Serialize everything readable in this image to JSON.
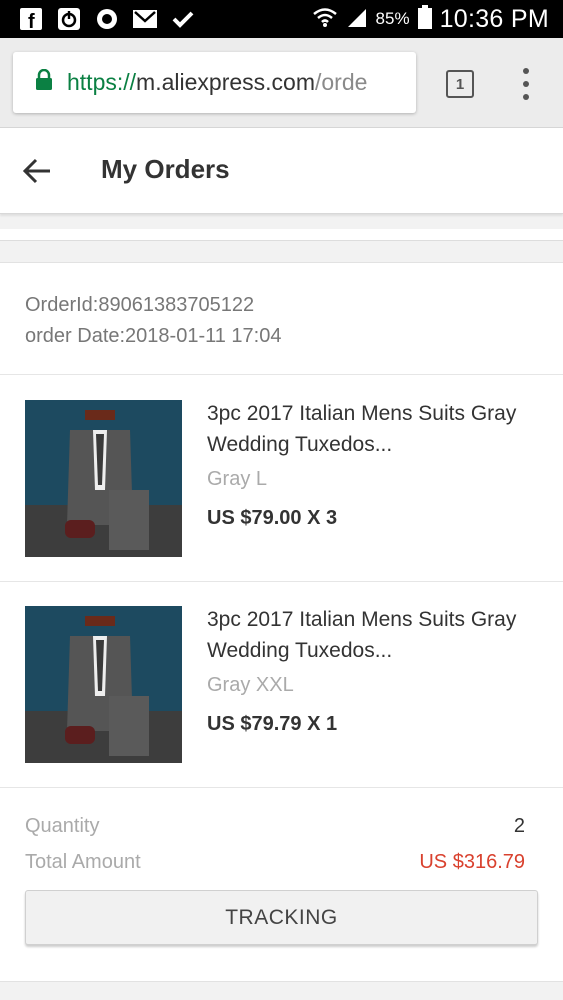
{
  "status_bar": {
    "left_icons": [
      "facebook-icon",
      "power-icon",
      "app-icon",
      "gmail-icon",
      "task-icon"
    ],
    "wifi": "wifi-icon",
    "signal": "signal-icon",
    "battery_percent": "85%",
    "time": "10:36 PM"
  },
  "browser": {
    "url_scheme": "https://",
    "url_host": "m.aliexpress.com",
    "url_path": "/orde",
    "tab_count": "1"
  },
  "header": {
    "title": "My Orders"
  },
  "order": {
    "id_text": "OrderId:89061383705122",
    "date_text": "order Date:2018-01-11 17:04",
    "items": [
      {
        "title": "3pc 2017 Italian Mens Suits Gray Wedding Tuxedos...",
        "variant": "Gray L",
        "price": "US $79.00 X 3"
      },
      {
        "title": "3pc 2017 Italian Mens Suits Gray Wedding Tuxedos...",
        "variant": "Gray XXL",
        "price": "US $79.79 X 1"
      }
    ],
    "quantity_label": "Quantity",
    "quantity_value": "2",
    "total_label": "Total Amount",
    "total_value": "US $316.79",
    "tracking_label": "TRACKING"
  },
  "colors": {
    "accent_total": "#d9412e",
    "secure_green": "#0b8043"
  }
}
